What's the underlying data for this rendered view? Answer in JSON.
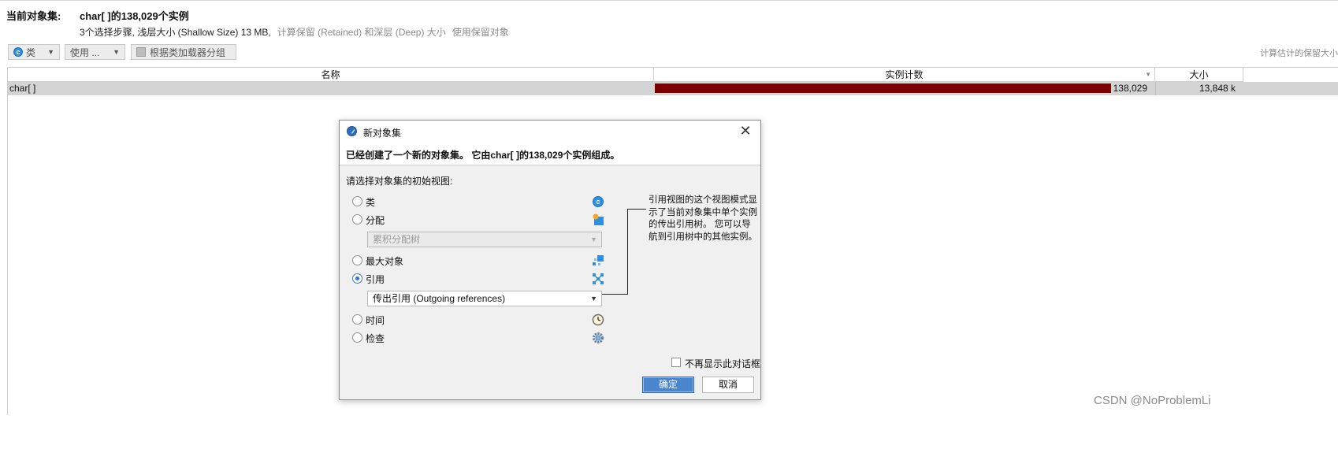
{
  "header": {
    "label": "当前对象集:",
    "title": "char[ ]的138,029个实例",
    "summary": "3个选择步骤, 浅层大小 (Shallow Size) 13 MB,",
    "link_retained_deep": "计算保留 (Retained) 和深层 (Deep) 大小",
    "link_use_retained": "使用保留对象"
  },
  "toolbar": {
    "class_button": "类",
    "use_button": "使用 ...",
    "group_button": "根据类加载器分组",
    "right_link": "计算估计的保留大小"
  },
  "table": {
    "columns": [
      "名称",
      "实例计数",
      "大小"
    ],
    "rows": [
      {
        "name": "char[ ]",
        "count": "138,029",
        "count_fraction": 1.0,
        "size": "13,848 k"
      }
    ]
  },
  "dialog": {
    "title": "新对象集",
    "message": "已经创建了一个新的对象集。 它由char[ ]的138,029个实例组成。",
    "prompt": "请选择对象集的初始视图:",
    "options": [
      {
        "label": "类",
        "icon": "class-icon",
        "selected": false
      },
      {
        "label": "分配",
        "icon": "allocation-icon",
        "selected": false
      },
      {
        "label": "最大对象",
        "icon": "biggest-objects-icon",
        "selected": false
      },
      {
        "label": "引用",
        "icon": "references-icon",
        "selected": true
      },
      {
        "label": "时间",
        "icon": "time-icon",
        "selected": false
      },
      {
        "label": "检查",
        "icon": "inspection-gear-icon",
        "selected": false
      }
    ],
    "allocation_select": "累积分配树",
    "reference_select": "传出引用 (Outgoing references)",
    "description": "引用视图的这个视图模式显示了当前对象集中单个实例的传出引用树。 您可以导航到引用树中的其他实例。",
    "dont_show_again": "不再显示此对话框",
    "ok": "确定",
    "cancel": "取消"
  },
  "watermark": "CSDN @NoProblemLi",
  "colors": {
    "bar": "#7c0000",
    "accent": "#4a86cf"
  }
}
